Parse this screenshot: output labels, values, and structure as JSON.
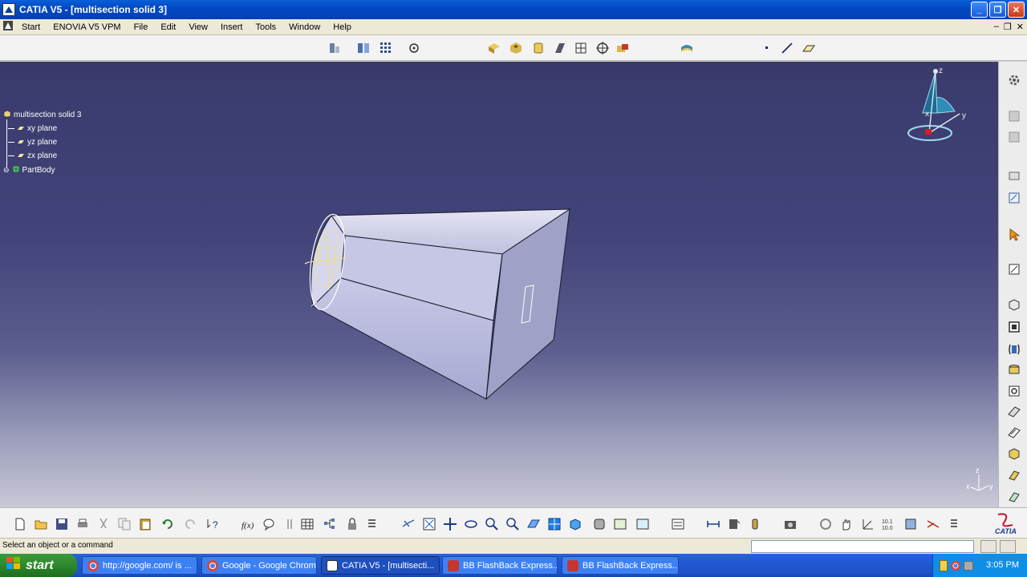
{
  "window": {
    "title": "CATIA V5 - [multisection solid 3]",
    "controls": [
      "_",
      "❐",
      "✕"
    ]
  },
  "menubar": {
    "items": [
      "Start",
      "ENOVIA V5 VPM",
      "File",
      "Edit",
      "View",
      "Insert",
      "Tools",
      "Window",
      "Help"
    ],
    "mdi_controls": [
      "‒",
      "❐",
      "✕"
    ]
  },
  "spec_tree": {
    "root": "multisection solid 3",
    "children": [
      "xy plane",
      "yz plane",
      "zx plane",
      "PartBody"
    ]
  },
  "compass": {
    "x_label": "x",
    "y_label": "y",
    "z_label": "z"
  },
  "axis_triad": {
    "x_label": "x",
    "y_label": "y",
    "z_label": "z"
  },
  "statusbar": {
    "message": "Select an object or a command",
    "command_input_placeholder": ""
  },
  "taskbar": {
    "start_label": "start",
    "buttons": [
      {
        "label": "http://google.com/ is ...",
        "icon": "chrome-icon"
      },
      {
        "label": "Google - Google Chrome",
        "icon": "chrome-icon"
      },
      {
        "label": "CATIA V5 - [multisecti...",
        "icon": "catia-icon"
      },
      {
        "label": "BB FlashBack Express...",
        "icon": "flashback-icon"
      },
      {
        "label": "BB FlashBack Express...",
        "icon": "flashback-icon"
      }
    ],
    "clock": "3:05 PM"
  },
  "colors": {
    "viewport_top": "#393a6c",
    "viewport_bottom": "#c9c9d8",
    "titlebar": "#0349c4",
    "taskbar": "#245edb",
    "start_button": "#2d8a2d"
  }
}
